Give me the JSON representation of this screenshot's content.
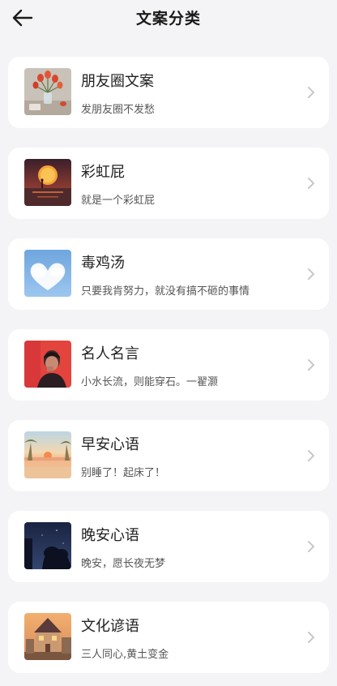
{
  "header": {
    "title": "文案分类",
    "back_icon": "arrow-left-icon"
  },
  "categories": [
    {
      "title": "朋友圈文案",
      "subtitle": "发朋友圈不发愁",
      "thumb": "tulips-vase"
    },
    {
      "title": "彩虹屁",
      "subtitle": "就是一个彩虹屁",
      "thumb": "sunset-sea"
    },
    {
      "title": "毒鸡汤",
      "subtitle": "只要我肯努力，就没有搞不砸的事情",
      "thumb": "heart-cloud"
    },
    {
      "title": "名人名言",
      "subtitle": "小水长流，则能穿石。一翟灏",
      "thumb": "man-portrait-red"
    },
    {
      "title": "早安心语",
      "subtitle": "别睡了！起床了！",
      "thumb": "morning-beach"
    },
    {
      "title": "晚安心语",
      "subtitle": "晚安，愿长夜无梦",
      "thumb": "night-trees"
    },
    {
      "title": "文化谚语",
      "subtitle": "三人同心,黄土变金",
      "thumb": "old-house"
    }
  ],
  "colors": {
    "background": "#f4f4f6",
    "card": "#ffffff",
    "title_text": "#1a1a1a",
    "subtitle_text": "#555555",
    "chevron": "#c8c8c8"
  }
}
